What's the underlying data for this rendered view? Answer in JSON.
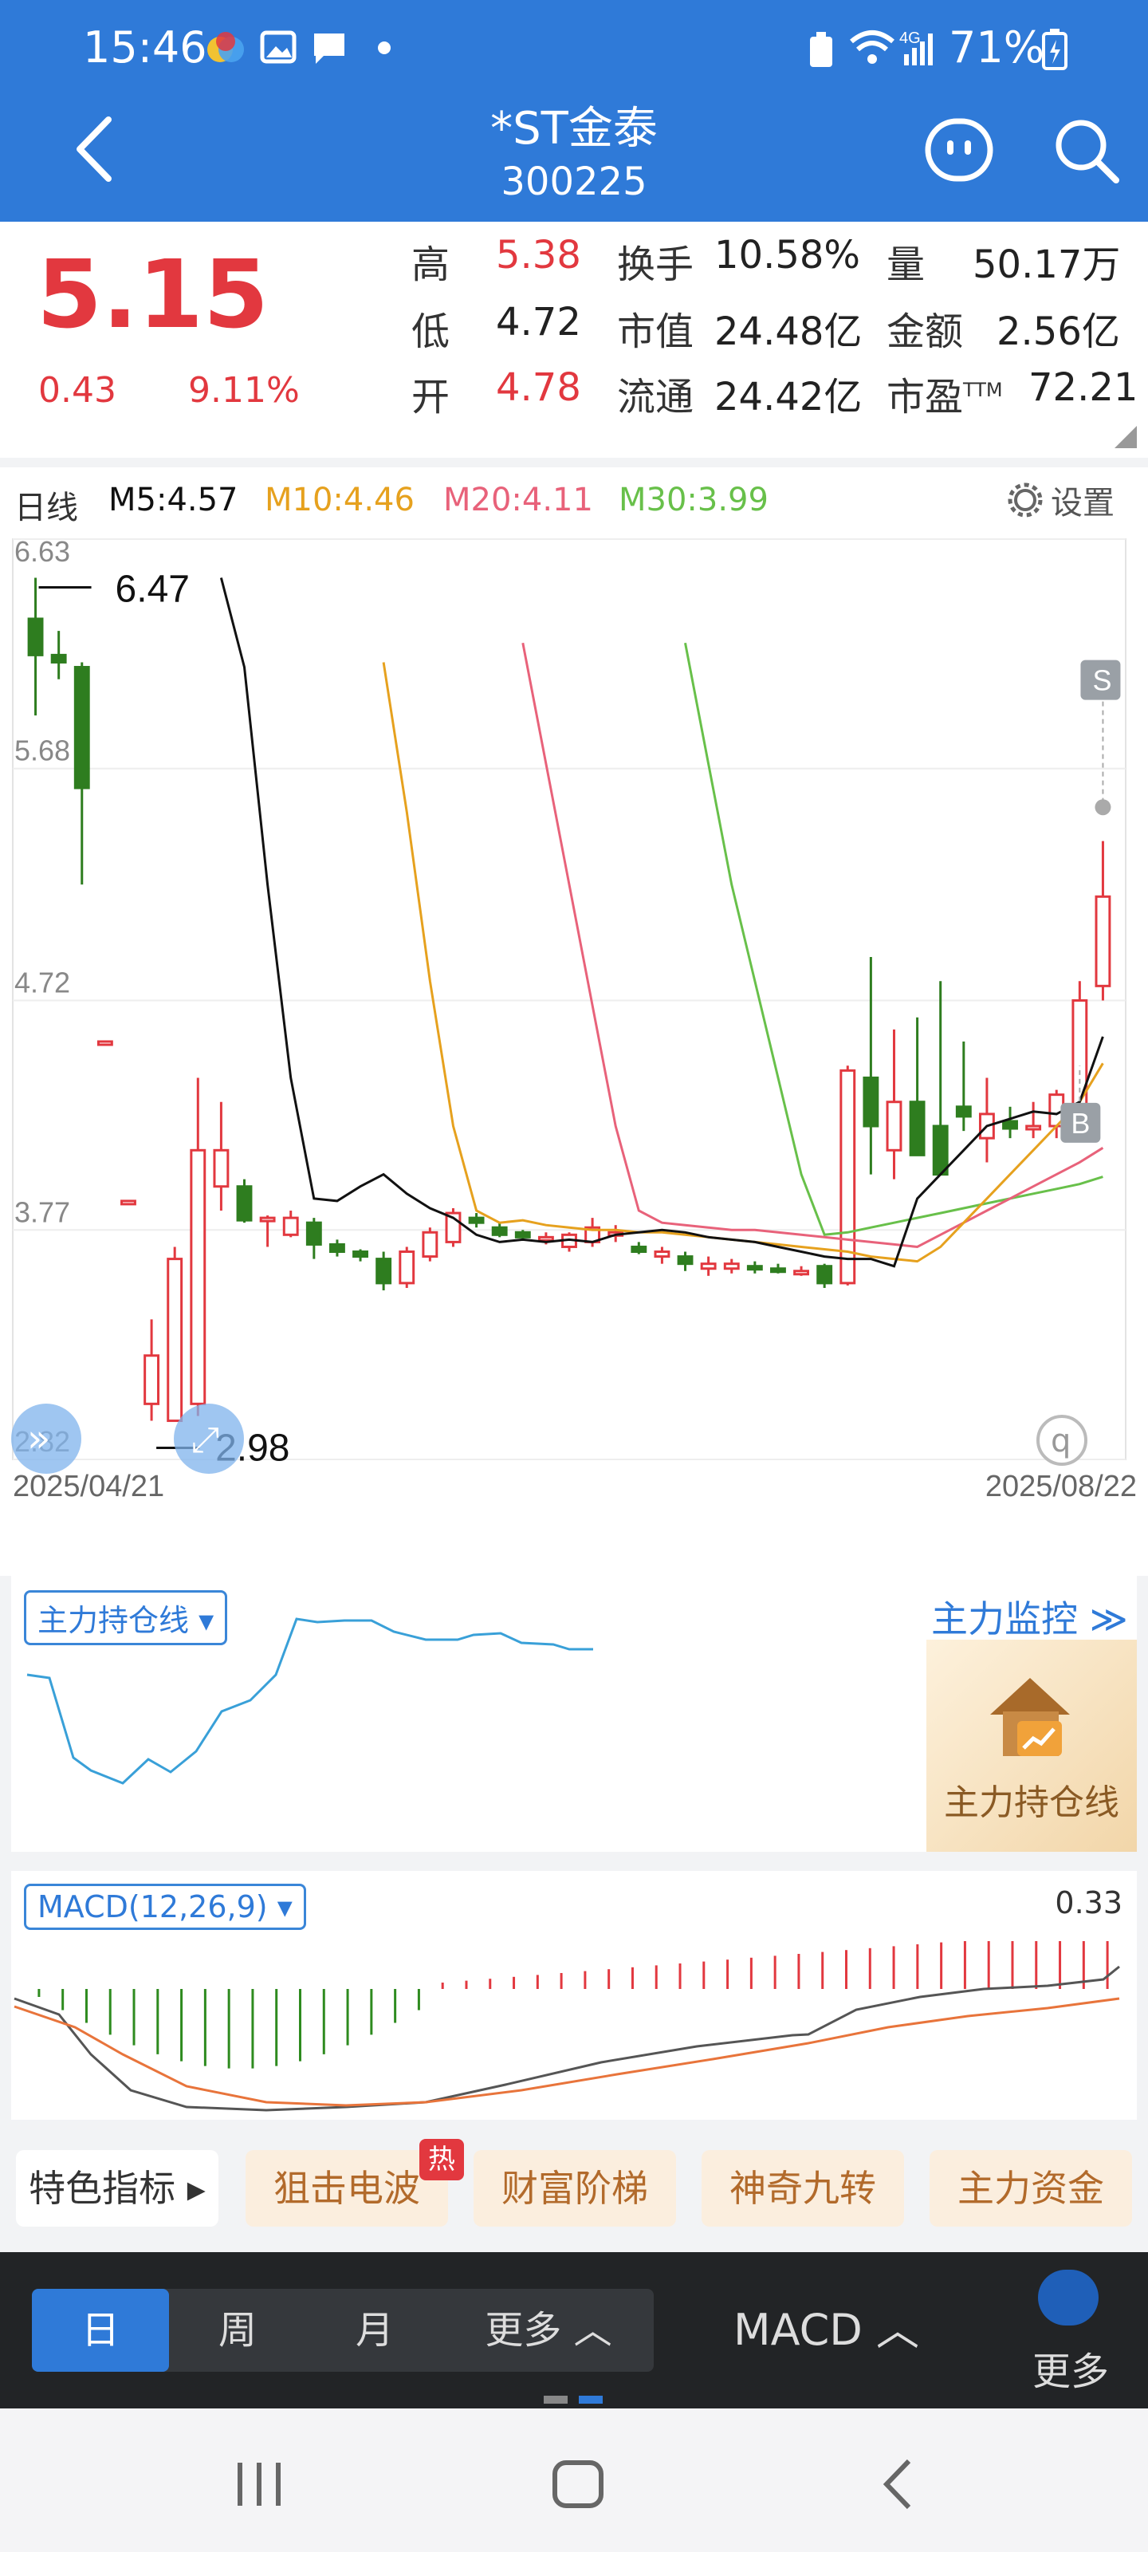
{
  "status": {
    "time": "15:46",
    "network": "4G",
    "battery": "71%"
  },
  "header": {
    "title": "*ST金泰",
    "code": "300225"
  },
  "quote": {
    "price": "5.15",
    "change": "0.43",
    "change_pct": "9.11%",
    "high_label": "高",
    "high": "5.38",
    "low_label": "低",
    "low": "4.72",
    "open_label": "开",
    "open": "4.78",
    "turnover_label": "换手",
    "turnover": "10.58%",
    "mcap_label": "市值",
    "mcap": "24.48亿",
    "float_label": "流通",
    "float": "24.42亿",
    "vol_label": "量",
    "vol": "50.17万",
    "amount_label": "金额",
    "amount": "2.56亿",
    "pe_label": "市盈",
    "pe_sup": "TTM",
    "pe": "72.21"
  },
  "kline": {
    "period_label": "日线",
    "ma5": "M5:4.57",
    "ma10": "M10:4.46",
    "ma20": "M20:4.11",
    "ma30": "M30:3.99",
    "settings": "设置",
    "y_ticks": [
      "6.63",
      "5.68",
      "4.72",
      "3.77",
      "2.82"
    ],
    "max_label": "6.47",
    "min_label": "2.98",
    "date_start": "2025/04/21",
    "date_end": "2025/08/22",
    "badge_s": "S",
    "badge_b": "B",
    "colors": {
      "up": "#e2383f",
      "down": "#2e7d1f",
      "ma5": "#111111",
      "ma10": "#e6a11e",
      "ma20": "#e8627a",
      "ma30": "#68c04a"
    }
  },
  "chart_data": {
    "type": "candlestick",
    "x_range": [
      "2025/04/21",
      "2025/08/22"
    ],
    "ylim": [
      2.82,
      6.63
    ],
    "candles": [
      {
        "o": 6.3,
        "h": 6.47,
        "l": 5.9,
        "c": 6.15
      },
      {
        "o": 6.15,
        "h": 6.25,
        "l": 6.05,
        "c": 6.12
      },
      {
        "o": 6.1,
        "h": 6.12,
        "l": 5.2,
        "c": 5.6
      },
      {
        "o": 4.55,
        "h": 4.55,
        "l": 4.55,
        "c": 4.55
      },
      {
        "o": 3.89,
        "h": 3.89,
        "l": 3.89,
        "c": 3.89
      },
      {
        "o": 3.05,
        "h": 3.4,
        "l": 2.98,
        "c": 3.25
      },
      {
        "o": 2.98,
        "h": 3.7,
        "l": 2.98,
        "c": 3.65
      },
      {
        "o": 3.05,
        "h": 4.4,
        "l": 3.0,
        "c": 4.1
      },
      {
        "o": 3.95,
        "h": 4.3,
        "l": 3.85,
        "c": 4.1
      },
      {
        "o": 3.95,
        "h": 3.98,
        "l": 3.8,
        "c": 3.81
      },
      {
        "o": 3.82,
        "h": 3.83,
        "l": 3.7,
        "c": 3.82
      },
      {
        "o": 3.75,
        "h": 3.85,
        "l": 3.74,
        "c": 3.82
      },
      {
        "o": 3.8,
        "h": 3.82,
        "l": 3.65,
        "c": 3.71
      },
      {
        "o": 3.71,
        "h": 3.73,
        "l": 3.66,
        "c": 3.68
      },
      {
        "o": 3.68,
        "h": 3.69,
        "l": 3.64,
        "c": 3.66
      },
      {
        "o": 3.65,
        "h": 3.68,
        "l": 3.52,
        "c": 3.55
      },
      {
        "o": 3.55,
        "h": 3.7,
        "l": 3.53,
        "c": 3.68
      },
      {
        "o": 3.66,
        "h": 3.78,
        "l": 3.64,
        "c": 3.76
      },
      {
        "o": 3.72,
        "h": 3.86,
        "l": 3.7,
        "c": 3.84
      },
      {
        "o": 3.82,
        "h": 3.84,
        "l": 3.78,
        "c": 3.8
      },
      {
        "o": 3.78,
        "h": 3.8,
        "l": 3.74,
        "c": 3.75
      },
      {
        "o": 3.76,
        "h": 3.77,
        "l": 3.73,
        "c": 3.74
      },
      {
        "o": 3.73,
        "h": 3.76,
        "l": 3.71,
        "c": 3.74
      },
      {
        "o": 3.7,
        "h": 3.76,
        "l": 3.68,
        "c": 3.75
      },
      {
        "o": 3.72,
        "h": 3.82,
        "l": 3.7,
        "c": 3.78
      },
      {
        "o": 3.76,
        "h": 3.79,
        "l": 3.72,
        "c": 3.76
      },
      {
        "o": 3.7,
        "h": 3.72,
        "l": 3.67,
        "c": 3.68
      },
      {
        "o": 3.66,
        "h": 3.7,
        "l": 3.63,
        "c": 3.68
      },
      {
        "o": 3.66,
        "h": 3.68,
        "l": 3.6,
        "c": 3.63
      },
      {
        "o": 3.61,
        "h": 3.66,
        "l": 3.58,
        "c": 3.63
      },
      {
        "o": 3.61,
        "h": 3.65,
        "l": 3.59,
        "c": 3.63
      },
      {
        "o": 3.62,
        "h": 3.64,
        "l": 3.59,
        "c": 3.61
      },
      {
        "o": 3.61,
        "h": 3.63,
        "l": 3.59,
        "c": 3.6
      },
      {
        "o": 3.59,
        "h": 3.62,
        "l": 3.58,
        "c": 3.6
      },
      {
        "o": 3.62,
        "h": 3.63,
        "l": 3.53,
        "c": 3.55
      },
      {
        "o": 3.55,
        "h": 4.45,
        "l": 3.54,
        "c": 4.43
      },
      {
        "o": 4.4,
        "h": 4.9,
        "l": 4.0,
        "c": 4.2
      },
      {
        "o": 4.1,
        "h": 4.6,
        "l": 3.98,
        "c": 4.3
      },
      {
        "o": 4.3,
        "h": 4.65,
        "l": 4.1,
        "c": 4.08
      },
      {
        "o": 4.2,
        "h": 4.8,
        "l": 4.0,
        "c": 4.0
      },
      {
        "o": 4.28,
        "h": 4.55,
        "l": 4.18,
        "c": 4.24
      },
      {
        "o": 4.15,
        "h": 4.4,
        "l": 4.05,
        "c": 4.25
      },
      {
        "o": 4.22,
        "h": 4.28,
        "l": 4.15,
        "c": 4.19
      },
      {
        "o": 4.2,
        "h": 4.3,
        "l": 4.15,
        "c": 4.2
      },
      {
        "o": 4.2,
        "h": 4.35,
        "l": 4.15,
        "c": 4.33
      },
      {
        "o": 4.28,
        "h": 4.8,
        "l": 4.25,
        "c": 4.72
      },
      {
        "o": 4.78,
        "h": 5.38,
        "l": 4.72,
        "c": 5.15
      }
    ],
    "ma5": [
      6.47,
      6.1,
      5.2,
      4.4,
      3.9,
      3.89,
      3.95,
      4.0,
      3.92,
      3.86,
      3.82,
      3.75,
      3.72,
      3.73,
      3.72,
      3.73,
      3.72,
      3.75,
      3.76,
      3.77,
      3.76,
      3.74,
      3.73,
      3.72,
      3.7,
      3.68,
      3.66,
      3.65,
      3.65,
      3.62,
      3.9,
      4.0,
      4.1,
      4.2,
      4.23,
      4.26,
      4.25,
      4.3,
      4.57
    ],
    "ma10": [
      6.12,
      5.5,
      4.8,
      4.2,
      3.85,
      3.8,
      3.81,
      3.79,
      3.78,
      3.77,
      3.77,
      3.76,
      3.76,
      3.75,
      3.74,
      3.73,
      3.72,
      3.71,
      3.7,
      3.69,
      3.68,
      3.66,
      3.65,
      3.64,
      3.7,
      3.8,
      3.9,
      4.0,
      4.1,
      4.2,
      4.3,
      4.46
    ],
    "ma20": [
      6.2,
      5.7,
      5.2,
      4.7,
      4.2,
      3.85,
      3.8,
      3.79,
      3.78,
      3.77,
      3.77,
      3.76,
      3.75,
      3.74,
      3.73,
      3.72,
      3.71,
      3.7,
      3.75,
      3.8,
      3.85,
      3.9,
      3.95,
      4.0,
      4.05,
      4.11
    ],
    "ma30": [
      6.2,
      5.7,
      5.2,
      4.8,
      4.4,
      4.0,
      3.75,
      3.76,
      3.78,
      3.8,
      3.82,
      3.84,
      3.86,
      3.88,
      3.9,
      3.92,
      3.94,
      3.96,
      3.99
    ]
  },
  "zlccx": {
    "dropdown": "主力持仓线",
    "monitor_link": "主力监控",
    "promo_label": "主力持仓线"
  },
  "macd": {
    "dropdown": "MACD(12,26,9)",
    "value": "0.33"
  },
  "features": {
    "label": "特色指标",
    "chips": [
      "狙击电波",
      "财富阶梯",
      "神奇九转",
      "主力资金"
    ],
    "hot_badge": "热"
  },
  "bottom_tabs": {
    "day": "日",
    "week": "周",
    "month": "月",
    "more": "更多",
    "indicator": "MACD",
    "more_btn": "更多"
  }
}
